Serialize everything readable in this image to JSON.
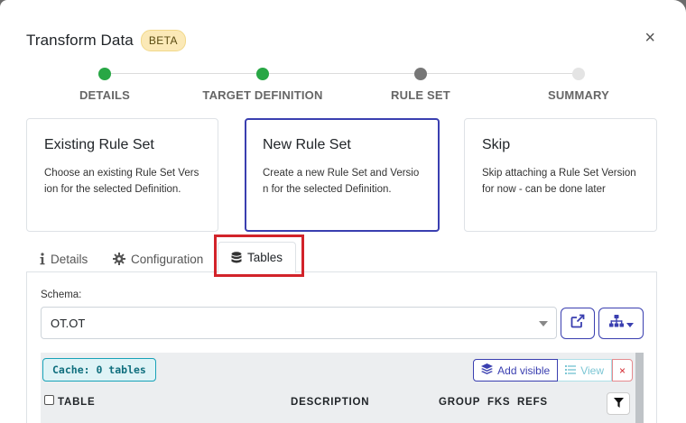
{
  "modal": {
    "title": "Transform Data",
    "badge": "BETA",
    "close": "×"
  },
  "stepper": {
    "steps": [
      {
        "label": "DETAILS",
        "state": "complete",
        "color": "#28a745"
      },
      {
        "label": "TARGET DEFINITION",
        "state": "complete",
        "color": "#28a745"
      },
      {
        "label": "RULE SET",
        "state": "current",
        "color": "#777777"
      },
      {
        "label": "SUMMARY",
        "state": "pending",
        "color": "#dddddd"
      }
    ]
  },
  "options": [
    {
      "title": "Existing Rule Set",
      "desc": "Choose an existing Rule Set Version for the selected Definition.",
      "selected": false
    },
    {
      "title": "New Rule Set",
      "desc": "Create a new Rule Set and Version for the selected Definition.",
      "selected": true
    },
    {
      "title": "Skip",
      "desc": "Skip attaching a Rule Set Version for now - can be done later",
      "selected": false
    }
  ],
  "tabs": [
    {
      "label": "Details",
      "icon": "info-icon"
    },
    {
      "label": "Configuration",
      "icon": "gear-icon"
    },
    {
      "label": "Tables",
      "icon": "database-icon",
      "active": true
    }
  ],
  "schema": {
    "label": "Schema:",
    "value": "OT.OT"
  },
  "tables": {
    "cache_badge": "Cache: 0 tables",
    "add_visible": "Add visible",
    "view": "View",
    "delete": "×",
    "columns": [
      "TABLE",
      "DESCRIPTION",
      "GROUP",
      "FKS",
      "REFS"
    ]
  },
  "colors": {
    "accent": "#3a3fb0",
    "highlight": "#d2232a",
    "cache": "#17a2b8"
  }
}
